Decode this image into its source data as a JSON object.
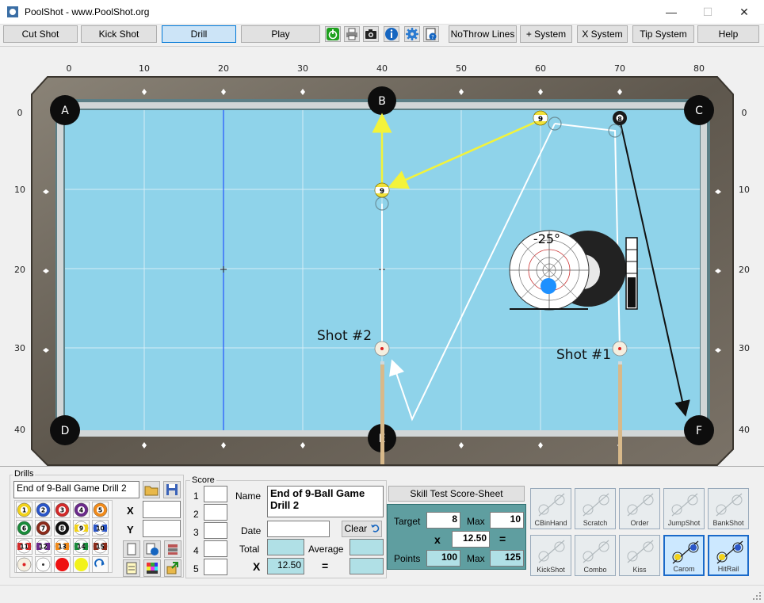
{
  "window": {
    "title": "PoolShot - www.PoolShot.org",
    "minimize": "—",
    "maximize": "☐",
    "close": "✕"
  },
  "toolbar": {
    "buttons": [
      "Cut Shot",
      "Kick Shot",
      "Drill",
      "Play"
    ],
    "active": "Drill",
    "icons": [
      "power-icon",
      "print-icon",
      "camera-icon",
      "info-icon",
      "settings-icon",
      "help-doc-icon"
    ],
    "right_buttons": [
      "NoThrow Lines",
      "+ System",
      "X System",
      "Tip System",
      "Help"
    ]
  },
  "table": {
    "x_ticks": [
      "0",
      "10",
      "20",
      "30",
      "40",
      "50",
      "60",
      "70",
      "80"
    ],
    "y_ticks": [
      "0",
      "10",
      "20",
      "30",
      "40"
    ],
    "pockets": [
      "A",
      "B",
      "C",
      "D",
      "E",
      "F"
    ],
    "shot1_label": "Shot #1",
    "shot2_label": "Shot #2",
    "ball_9": "9",
    "ball_8": "8",
    "cue_angle": "-25°",
    "cue_ball_number": "8"
  },
  "drills": {
    "group_label": "Drills",
    "drill_name": "End of 9-Ball Game Drill 2",
    "balls": [
      "1",
      "2",
      "3",
      "4",
      "5",
      "6",
      "7",
      "8",
      "9",
      "10",
      "11",
      "12",
      "13",
      "14",
      "15"
    ],
    "x_label": "X",
    "y_label": "Y",
    "x_value": "",
    "y_value": ""
  },
  "score": {
    "group_label": "Score",
    "rows": [
      "1",
      "2",
      "3",
      "4",
      "5"
    ],
    "name_label": "Name",
    "name_value": "End of 9-Ball Game Drill 2",
    "date_label": "Date",
    "date_value": "",
    "clear_button": "Clear",
    "total_label": "Total",
    "total_value": "",
    "average_label": "Average",
    "average_value": "",
    "x_label": "X",
    "multiplier": "12.50",
    "equals": "=",
    "result": ""
  },
  "skill_test": {
    "title": "Skill Test Score-Sheet",
    "target_label": "Target",
    "target_value": "8",
    "max_label": "Max",
    "max_value": "10",
    "x_label": "x",
    "multiplier": "12.50",
    "equals": "=",
    "points_label": "Points",
    "points_value": "100",
    "points_max_label": "Max",
    "points_max_value": "125"
  },
  "skills": [
    {
      "label": "CBinHand",
      "active": false
    },
    {
      "label": "Scratch",
      "active": false
    },
    {
      "label": "Order",
      "active": false
    },
    {
      "label": "JumpShot",
      "active": false
    },
    {
      "label": "BankShot",
      "active": false
    },
    {
      "label": "KickShot",
      "active": false
    },
    {
      "label": "Combo",
      "active": false
    },
    {
      "label": "Kiss",
      "active": false
    },
    {
      "label": "Carom",
      "active": true
    },
    {
      "label": "HitRail",
      "active": true
    }
  ],
  "colors": {
    "felt": "#8fd3ea",
    "rail_wood": "#6b6459",
    "yellow_line": "#f3f33a",
    "accent": "#0078d7"
  }
}
